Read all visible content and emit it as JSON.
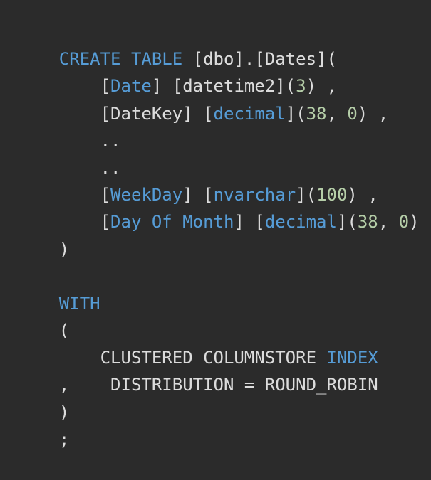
{
  "colors": {
    "background": "#2b2b2b",
    "keyword": "#569cd6",
    "number": "#b5cea8",
    "plain": "#dcdcdc"
  },
  "lines": [
    [
      {
        "t": "CREATE TABLE",
        "c": "kw"
      },
      {
        "t": " [dbo].[Dates](",
        "c": "plain"
      }
    ],
    [
      {
        "t": "    [",
        "c": "plain"
      },
      {
        "t": "Date",
        "c": "kw"
      },
      {
        "t": "] [datetime2](",
        "c": "plain"
      },
      {
        "t": "3",
        "c": "num"
      },
      {
        "t": ") ,",
        "c": "plain"
      }
    ],
    [
      {
        "t": "    [DateKey] [",
        "c": "plain"
      },
      {
        "t": "decimal",
        "c": "kw"
      },
      {
        "t": "](",
        "c": "plain"
      },
      {
        "t": "38",
        "c": "num"
      },
      {
        "t": ", ",
        "c": "plain"
      },
      {
        "t": "0",
        "c": "num"
      },
      {
        "t": ") ,",
        "c": "plain"
      }
    ],
    [
      {
        "t": "    ..",
        "c": "plain"
      }
    ],
    [
      {
        "t": "    ..",
        "c": "plain"
      }
    ],
    [
      {
        "t": "    [",
        "c": "plain"
      },
      {
        "t": "WeekDay",
        "c": "kw"
      },
      {
        "t": "] [",
        "c": "plain"
      },
      {
        "t": "nvarchar",
        "c": "kw"
      },
      {
        "t": "](",
        "c": "plain"
      },
      {
        "t": "100",
        "c": "num"
      },
      {
        "t": ") ,",
        "c": "plain"
      }
    ],
    [
      {
        "t": "    [",
        "c": "plain"
      },
      {
        "t": "Day Of Month",
        "c": "kw"
      },
      {
        "t": "] [",
        "c": "plain"
      },
      {
        "t": "decimal",
        "c": "kw"
      },
      {
        "t": "](",
        "c": "plain"
      },
      {
        "t": "38",
        "c": "num"
      },
      {
        "t": ", ",
        "c": "plain"
      },
      {
        "t": "0",
        "c": "num"
      },
      {
        "t": ")",
        "c": "plain"
      }
    ],
    [
      {
        "t": ")",
        "c": "plain"
      }
    ],
    [
      {
        "t": "",
        "c": "plain"
      }
    ],
    [
      {
        "t": "WITH",
        "c": "kw"
      }
    ],
    [
      {
        "t": "(",
        "c": "plain"
      }
    ],
    [
      {
        "t": "    CLUSTERED COLUMNSTORE ",
        "c": "plain"
      },
      {
        "t": "INDEX",
        "c": "kw"
      }
    ],
    [
      {
        "t": ",    DISTRIBUTION = ROUND_ROBIN",
        "c": "plain"
      }
    ],
    [
      {
        "t": ")",
        "c": "plain"
      }
    ],
    [
      {
        "t": ";",
        "c": "plain"
      }
    ]
  ]
}
